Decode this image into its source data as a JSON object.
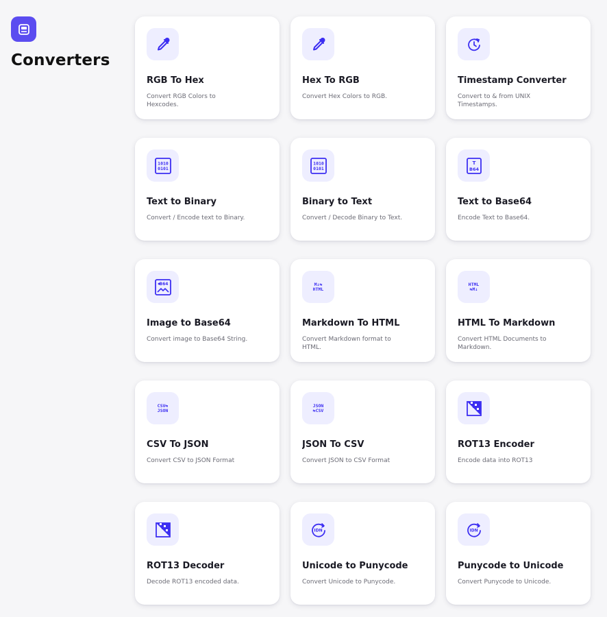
{
  "section": {
    "title": "Converters",
    "icon": "converter-icon"
  },
  "cards": [
    {
      "title": "RGB To Hex",
      "description": "Convert RGB Colors to Hexcodes.",
      "icon": "eyedropper-icon"
    },
    {
      "title": "Hex To RGB",
      "description": "Convert Hex Colors to RGB.",
      "icon": "eyedropper-icon"
    },
    {
      "title": "Timestamp Converter",
      "description": "Convert to & from UNIX Timestamps.",
      "icon": "clock-icon"
    },
    {
      "title": "Text to Binary",
      "description": "Convert / Encode text to Binary.",
      "icon": "binary-icon"
    },
    {
      "title": "Binary to Text",
      "description": "Convert / Decode Binary to Text.",
      "icon": "binary-icon"
    },
    {
      "title": "Text to Base64",
      "description": "Encode Text to Base64.",
      "icon": "text-base64-icon"
    },
    {
      "title": "Image to Base64",
      "description": "Convert image to Base64 String.",
      "icon": "image-base64-icon"
    },
    {
      "title": "Markdown To HTML",
      "description": "Convert Markdown format to HTML.",
      "icon": "markdown-html-icon"
    },
    {
      "title": "HTML To Markdown",
      "description": "Convert HTML Documents to Markdown.",
      "icon": "html-markdown-icon"
    },
    {
      "title": "CSV To JSON",
      "description": "Convert CSV to JSON Format",
      "icon": "csv-json-icon"
    },
    {
      "title": "JSON To CSV",
      "description": "Convert JSON to CSV Format",
      "icon": "json-csv-icon"
    },
    {
      "title": "ROT13 Encoder",
      "description": "Encode data into ROT13",
      "icon": "rot13-icon"
    },
    {
      "title": "ROT13 Decoder",
      "description": "Decode ROT13 encoded data.",
      "icon": "rot13-icon"
    },
    {
      "title": "Unicode to Punycode",
      "description": "Convert Unicode to Punycode.",
      "icon": "idn-icon"
    },
    {
      "title": "Punycode to Unicode",
      "description": "Convert Punycode to Unicode.",
      "icon": "idn-icon"
    }
  ],
  "icon_text": {
    "binary": [
      "1010",
      "0101"
    ],
    "b64": "B64",
    "t": "T",
    "md_html": [
      "M↓⇆",
      "HTML"
    ],
    "html_md": [
      "HTML",
      "⇆M↓"
    ],
    "csv_json": [
      "CSV⇆",
      "JSON"
    ],
    "json_csv": [
      "JSON",
      "⇆CSV"
    ],
    "idn": "IDN"
  },
  "colors": {
    "accent": "#3c2ef2",
    "icon_bg": "#eeeeff",
    "section_icon_bg": "#5b4cf0"
  }
}
